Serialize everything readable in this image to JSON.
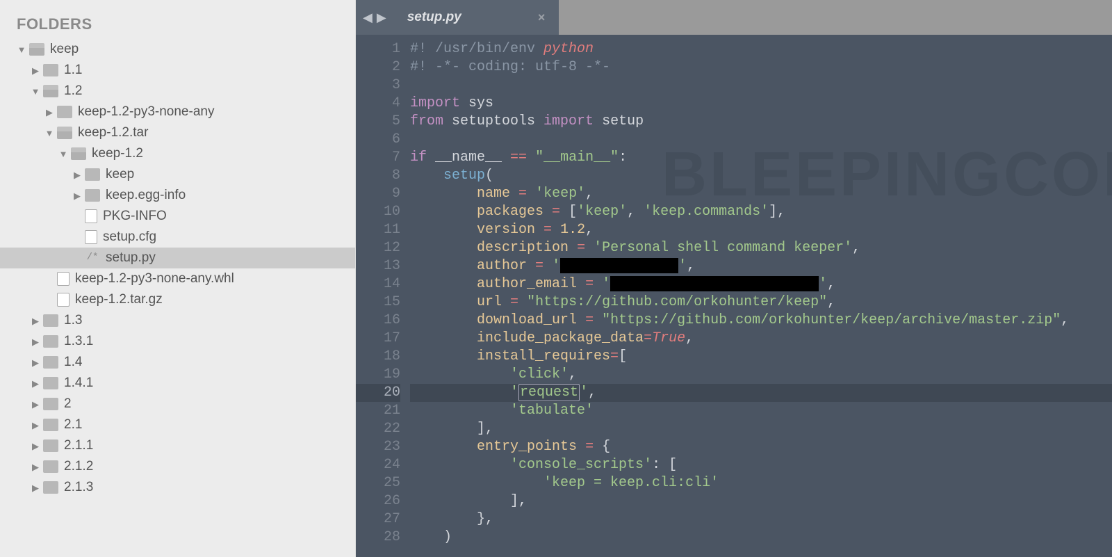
{
  "sidebar": {
    "header": "FOLDERS",
    "items": [
      {
        "label": "keep",
        "type": "folder-open",
        "arrow": "open",
        "indent": 0
      },
      {
        "label": "1.1",
        "type": "folder",
        "arrow": "closed",
        "indent": 1
      },
      {
        "label": "1.2",
        "type": "folder-open",
        "arrow": "open",
        "indent": 1
      },
      {
        "label": "keep-1.2-py3-none-any",
        "type": "folder",
        "arrow": "closed",
        "indent": 2
      },
      {
        "label": "keep-1.2.tar",
        "type": "folder-open",
        "arrow": "open",
        "indent": 2
      },
      {
        "label": "keep-1.2",
        "type": "folder-open",
        "arrow": "open",
        "indent": 3
      },
      {
        "label": "keep",
        "type": "folder",
        "arrow": "closed",
        "indent": 4
      },
      {
        "label": "keep.egg-info",
        "type": "folder",
        "arrow": "closed",
        "indent": 4
      },
      {
        "label": "PKG-INFO",
        "type": "file",
        "arrow": "none",
        "indent": 4
      },
      {
        "label": "setup.cfg",
        "type": "file",
        "arrow": "none",
        "indent": 4
      },
      {
        "label": "setup.py",
        "type": "py",
        "arrow": "none",
        "indent": 4,
        "selected": true
      },
      {
        "label": "keep-1.2-py3-none-any.whl",
        "type": "file",
        "arrow": "none",
        "indent": 2
      },
      {
        "label": "keep-1.2.tar.gz",
        "type": "file",
        "arrow": "none",
        "indent": 2
      },
      {
        "label": "1.3",
        "type": "folder",
        "arrow": "closed",
        "indent": 1
      },
      {
        "label": "1.3.1",
        "type": "folder",
        "arrow": "closed",
        "indent": 1
      },
      {
        "label": "1.4",
        "type": "folder",
        "arrow": "closed",
        "indent": 1
      },
      {
        "label": "1.4.1",
        "type": "folder",
        "arrow": "closed",
        "indent": 1
      },
      {
        "label": "2",
        "type": "folder",
        "arrow": "closed",
        "indent": 1
      },
      {
        "label": "2.1",
        "type": "folder",
        "arrow": "closed",
        "indent": 1
      },
      {
        "label": "2.1.1",
        "type": "folder",
        "arrow": "closed",
        "indent": 1
      },
      {
        "label": "2.1.2",
        "type": "folder",
        "arrow": "closed",
        "indent": 1
      },
      {
        "label": "2.1.3",
        "type": "folder",
        "arrow": "closed",
        "indent": 1
      }
    ]
  },
  "tab": {
    "filename": "setup.py"
  },
  "watermark": "BLEEPINGCOMPUTER",
  "code": {
    "line_count": 28,
    "highlighted_line": 20,
    "lines": {
      "l1_comment": "#! /usr/bin/env ",
      "l1_python": "python",
      "l2": "#! -*- coding: utf-8 -*-",
      "l4_import": "import",
      "l4_sys": " sys",
      "l5_from": "from",
      "l5_setuptools": " setuptools ",
      "l5_import": "import",
      "l5_setup": " setup",
      "l7_if": "if",
      "l7_name": " __name__ ",
      "l7_eq": "==",
      "l7_main": " \"__main__\"",
      "l8_setup": "setup",
      "l9_name": "name",
      "l9_val": "'keep'",
      "l10_packages": "packages",
      "l10_keep": "'keep'",
      "l10_commands": "'keep.commands'",
      "l11_version": "version",
      "l11_val": "1.2",
      "l12_desc": "description",
      "l12_val": "'Personal shell command keeper'",
      "l13_author": "author",
      "l14_email": "author_email",
      "l15_url": "url",
      "l15_val": "\"https://github.com/orkohunter/keep\"",
      "l16_dl": "download_url",
      "l16_val": "\"https://github.com/orkohunter/keep/archive/master.zip\"",
      "l17_inc": "include_package_data",
      "l17_true": "True",
      "l18_req": "install_requires",
      "l19_click": "'click'",
      "l20_request": "request",
      "l21_tabulate": "'tabulate'",
      "l23_entry": "entry_points",
      "l24_console": "'console_scripts'",
      "l25_keep": "'keep = keep.cli:cli'"
    }
  }
}
